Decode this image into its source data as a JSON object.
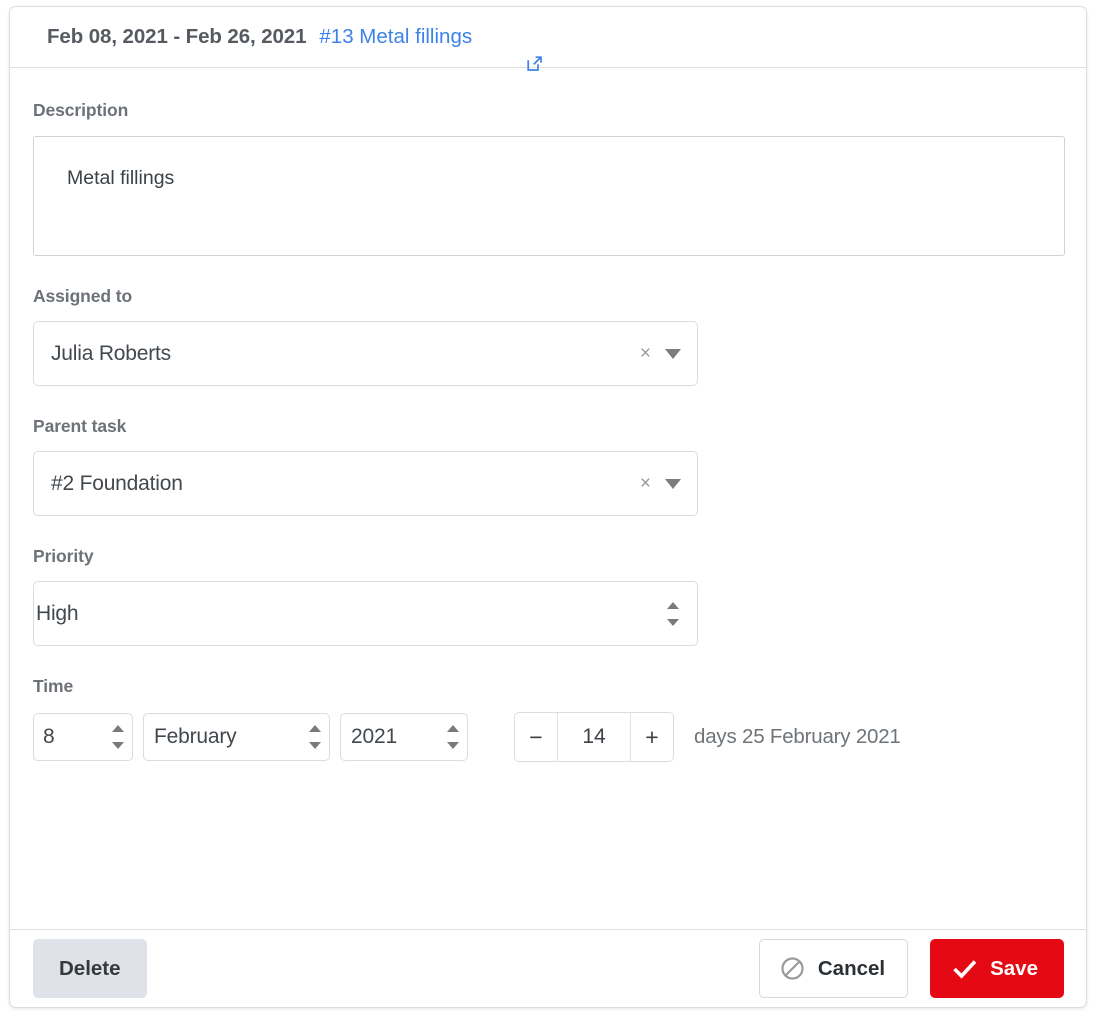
{
  "header": {
    "date_range": "Feb 08, 2021 - Feb 26, 2021",
    "task_link": "#13 Metal fillings",
    "external_link_icon": "external-link-icon"
  },
  "description": {
    "label": "Description",
    "value": "Metal fillings",
    "placeholder": ""
  },
  "assigned_to": {
    "label": "Assigned to",
    "value": "Julia Roberts",
    "clear_icon": "clear-x-icon",
    "caret_icon": "chevron-down-icon"
  },
  "parent_task": {
    "label": "Parent task",
    "value": "#2 Foundation",
    "clear_icon": "clear-x-icon",
    "caret_icon": "chevron-down-icon"
  },
  "priority": {
    "label": "Priority",
    "value": "High",
    "stepper_icon": "up-down-arrows-icon"
  },
  "time": {
    "label": "Time",
    "day": "8",
    "month": "February",
    "year": "2021",
    "duration": "14",
    "decrement_label": "−",
    "increment_label": "+",
    "due_text": "days 25 February 2021"
  },
  "footer": {
    "delete_label": "Delete",
    "cancel_label": "Cancel",
    "cancel_icon": "ban-icon",
    "save_label": "Save",
    "save_icon": "check-icon"
  },
  "colors": {
    "link": "#3d82e8",
    "save_bg": "#e50914",
    "delete_bg": "#dfe3e9",
    "label": "#6c7278"
  }
}
